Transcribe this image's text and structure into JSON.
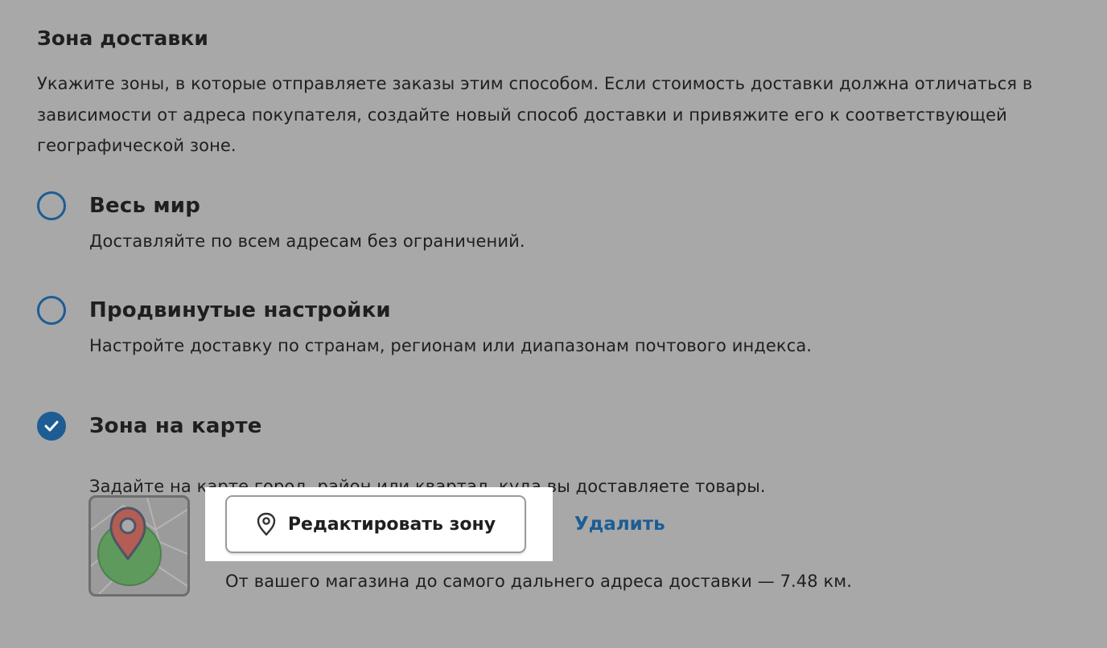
{
  "section": {
    "title": "Зона доставки",
    "description": "Укажите зоны, в которые отправляете заказы этим способом. Если стоимость доставки должна отличаться в зависимости от адреса покупателя, создайте новый способ доставки и привяжите его к соответствующей географической зоне."
  },
  "options": [
    {
      "title": "Весь мир",
      "description": "Доставляйте по всем адресам без ограничений.",
      "checked": false
    },
    {
      "title": "Продвинутые настройки",
      "description": "Настройте доставку по странам, регионам или диапазонам почтового индекса.",
      "checked": false
    },
    {
      "title": "Зона на карте",
      "description": "Задайте на карте город, район или квартал, куда вы доставляете товары.",
      "checked": true
    }
  ],
  "map_zone": {
    "edit_label": "Редактировать зону",
    "delete_label": "Удалить",
    "distance_note": "От вашего магазина до самого дальнего адреса доставки — 7.48 км.",
    "thumbnail_icon": "map-pin-icon",
    "edit_icon": "location-pin-icon"
  },
  "colors": {
    "background": "#a8a8a8",
    "accent": "#1d5d94",
    "highlight": "#ffffff",
    "zone_fill": "#5e9a5c",
    "pin_fill": "#b35d55"
  }
}
